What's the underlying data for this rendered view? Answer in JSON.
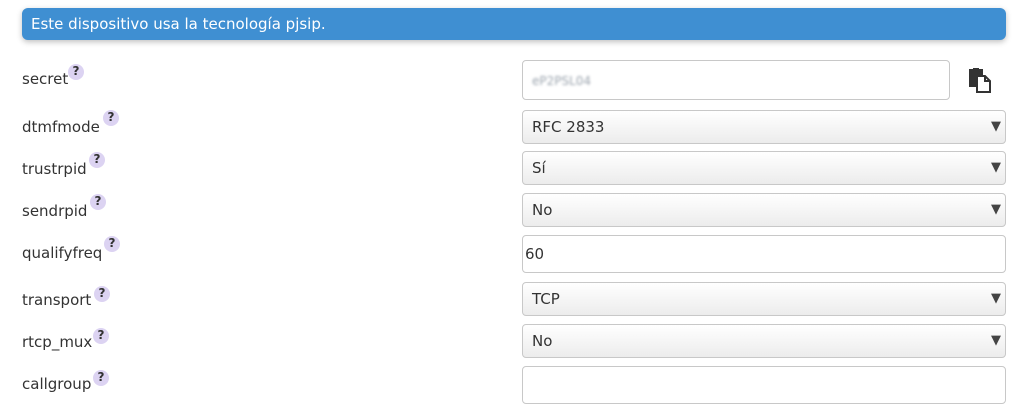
{
  "banner": {
    "text": "Este dispositivo usa la tecnología pjsip."
  },
  "help_mark": "?",
  "fields": {
    "secret": {
      "label": "secret",
      "value": "eP2PSL04"
    },
    "dtmfmode": {
      "label": "dtmfmode",
      "value": "RFC 2833"
    },
    "trustrpid": {
      "label": "trustrpid",
      "value": "Sí"
    },
    "sendrpid": {
      "label": "sendrpid",
      "value": "No"
    },
    "qualifyfreq": {
      "label": "qualifyfreq",
      "value": "60"
    },
    "transport": {
      "label": "transport",
      "value": "TCP"
    },
    "rtcp_mux": {
      "label": "rtcp_mux",
      "value": "No"
    },
    "callgroup": {
      "label": "callgroup",
      "value": ""
    }
  },
  "caret": "▼",
  "icons": {
    "copy": "copy-icon"
  },
  "colors": {
    "banner": "#3f8fd2",
    "help_badge": "#dcd3f2"
  }
}
